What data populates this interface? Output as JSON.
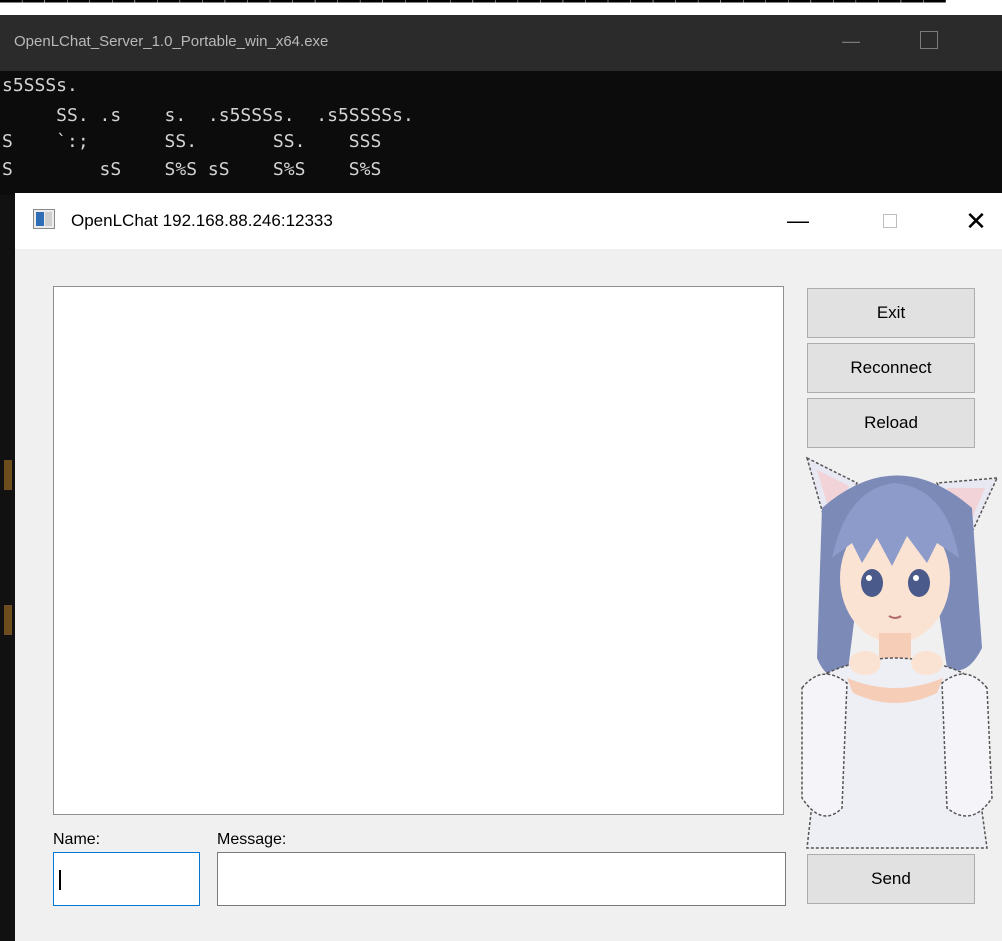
{
  "background_window": {
    "top_text": "(cut-off text)",
    "title": "OpenLChat_Server_1.0_Portable_win_x64.exe",
    "ascii_lines": [
      "s5SSSs.",
      "     SS. .s    s.  .s5SSSs.  .s5SSSSs.",
      "S    `:;       SS.       SS.    SSS",
      "S        sS    S%S sS    S%S    S%S"
    ]
  },
  "chat_window": {
    "title": "OpenLChat 192.168.88.246:12333",
    "minimize_symbol": "—",
    "close_symbol": "✕",
    "buttons": {
      "exit": "Exit",
      "reconnect": "Reconnect",
      "reload": "Reload",
      "send": "Send"
    },
    "labels": {
      "name": "Name:",
      "message": "Message:"
    },
    "inputs": {
      "name_value": "",
      "message_value": ""
    }
  },
  "colors": {
    "focus_border": "#0078d7",
    "button_bg": "#e1e1e1",
    "window_bg": "#f0f0f0"
  }
}
